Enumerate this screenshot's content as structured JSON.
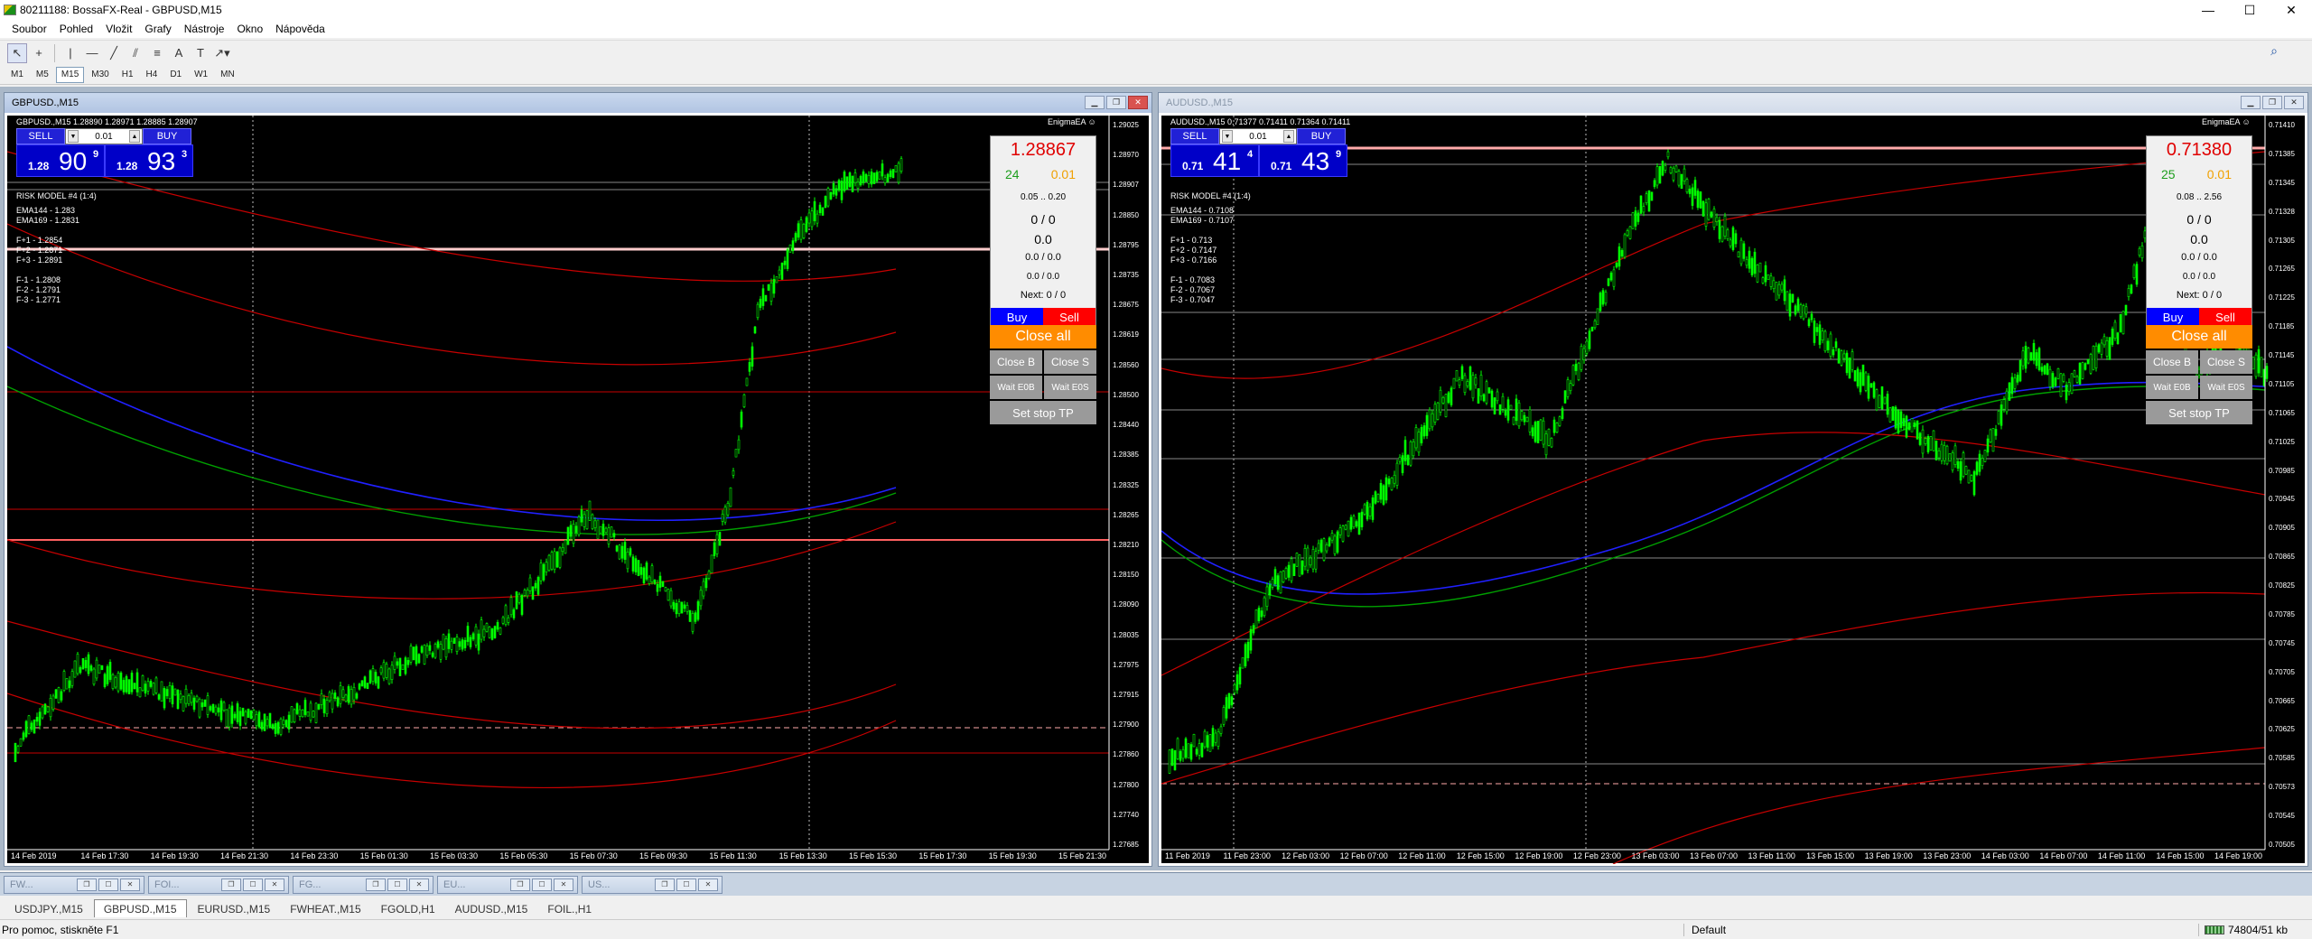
{
  "app": {
    "title": "80211188: BossaFX-Real - GBPUSD,M15",
    "controls": {
      "minimize": "—",
      "maximize": "☐",
      "close": "✕"
    }
  },
  "menu": [
    "Soubor",
    "Pohled",
    "Vložit",
    "Grafy",
    "Nástroje",
    "Okno",
    "Nápověda"
  ],
  "toolbar": {
    "tools": [
      "cursor-icon",
      "crosshair-icon",
      "vertical-line-icon",
      "horizontal-line-icon",
      "trendline-icon",
      "channel-icon",
      "fibonacci-icon",
      "text-icon",
      "label-icon",
      "arrows-icon"
    ],
    "glyphs": [
      "↖",
      "+",
      "|",
      "—",
      "╱",
      "⫽",
      "≡",
      "A",
      "T",
      "↗▾"
    ],
    "search_glyph": "⌕"
  },
  "timeframes": [
    "M1",
    "M5",
    "M15",
    "M30",
    "H1",
    "H4",
    "D1",
    "W1",
    "MN"
  ],
  "timeframe_active": "M15",
  "windows": [
    {
      "title": "GBPUSD.,M15",
      "info": "GBPUSD.,M15  1.28890 1.28971 1.28885 1.28907",
      "ea_label": "EnigmaEA ☺",
      "trade": {
        "sell": "SELL",
        "buy": "BUY",
        "lot": "0.01",
        "bid_small": "1.28",
        "bid_big": "90",
        "bid_sup": "9",
        "ask_small": "1.28",
        "ask_big": "93",
        "ask_sup": "3"
      },
      "risk": "RISK MODEL #4 (1:4)",
      "indicators": "EMA144 - 1.283\nEMA169 - 1.2831\n\nF+1 - 1.2854\nF+2 - 1.2871\nF+3 - 1.2891\n\nF-1 - 1.2808\nF-2 - 1.2791\nF-3 - 1.2771",
      "panel": {
        "price": "1.28867",
        "green": "24",
        "orange": "0.01",
        "range": "0.05 .. 0.20",
        "l1": "0 / 0",
        "l2": "0.0",
        "l3": "0.0 / 0.0",
        "l4": "0.0 / 0.0",
        "next": "Next: 0 / 0",
        "buy": "Buy",
        "sell": "Sell",
        "close_all": "Close all",
        "close_b": "Close B",
        "close_s": "Close S",
        "wait_eob": "Wait E0B",
        "wait_eos": "Wait E0S",
        "set_stop": "Set stop TP"
      },
      "price_labels": [
        "1.29025",
        "1.28970",
        "1.28907",
        "1.28850",
        "1.28795",
        "1.28735",
        "1.28675",
        "1.28619",
        "1.28560",
        "1.28500",
        "1.28440",
        "1.28385",
        "1.28325",
        "1.28265",
        "1.28210",
        "1.28150",
        "1.28090",
        "1.28035",
        "1.27975",
        "1.27915",
        "1.27900",
        "1.27860",
        "1.27800",
        "1.27740",
        "1.27685"
      ],
      "time_labels": [
        "14 Feb 2019",
        "14 Feb 17:30",
        "14 Feb 19:30",
        "14 Feb 21:30",
        "14 Feb 23:30",
        "15 Feb 01:30",
        "15 Feb 03:30",
        "15 Feb 05:30",
        "15 Feb 07:30",
        "15 Feb 09:30",
        "15 Feb 11:30",
        "15 Feb 13:30",
        "15 Feb 15:30",
        "15 Feb 17:30",
        "15 Feb 19:30",
        "15 Feb 21:30"
      ]
    },
    {
      "title": "AUDUSD.,M15",
      "info": "AUDUSD.,M15  0.71377 0.71411 0.71364 0.71411",
      "ea_label": "EnigmaEA ☺",
      "trade": {
        "sell": "SELL",
        "buy": "BUY",
        "lot": "0.01",
        "bid_small": "0.71",
        "bid_big": "41",
        "bid_sup": "4",
        "ask_small": "0.71",
        "ask_big": "43",
        "ask_sup": "9"
      },
      "risk": "RISK MODEL #4 (1:4)",
      "indicators": "EMA144 - 0.7108\nEMA169 - 0.7107\n\nF+1 - 0.713\nF+2 - 0.7147\nF+3 - 0.7166\n\nF-1 - 0.7083\nF-2 - 0.7067\nF-3 - 0.7047",
      "panel": {
        "price": "0.71380",
        "green": "25",
        "orange": "0.01",
        "range": "0.08 .. 2.56",
        "l1": "0 / 0",
        "l2": "0.0",
        "l3": "0.0 / 0.0",
        "l4": "0.0 / 0.0",
        "next": "Next: 0 / 0",
        "buy": "Buy",
        "sell": "Sell",
        "close_all": "Close all",
        "close_b": "Close B",
        "close_s": "Close S",
        "wait_eob": "Wait E0B",
        "wait_eos": "Wait E0S",
        "set_stop": "Set stop TP"
      },
      "price_labels": [
        "0.71410",
        "0.71385",
        "0.71345",
        "0.71328",
        "0.71305",
        "0.71265",
        "0.71225",
        "0.71185",
        "0.71145",
        "0.71105",
        "0.71065",
        "0.71025",
        "0.70985",
        "0.70945",
        "0.70905",
        "0.70865",
        "0.70825",
        "0.70785",
        "0.70745",
        "0.70705",
        "0.70665",
        "0.70625",
        "0.70585",
        "0.70573",
        "0.70545",
        "0.70505"
      ],
      "time_labels": [
        "11 Feb 2019",
        "11 Feb 23:00",
        "12 Feb 03:00",
        "12 Feb 07:00",
        "12 Feb 11:00",
        "12 Feb 15:00",
        "12 Feb 19:00",
        "12 Feb 23:00",
        "13 Feb 03:00",
        "13 Feb 07:00",
        "13 Feb 11:00",
        "13 Feb 15:00",
        "13 Feb 19:00",
        "13 Feb 23:00",
        "14 Feb 03:00",
        "14 Feb 07:00",
        "14 Feb 11:00",
        "14 Feb 15:00",
        "14 Feb 19:00"
      ]
    }
  ],
  "minimized": [
    "FW...",
    "FOI...",
    "FG...",
    "EU...",
    "US..."
  ],
  "tabs": [
    "USDJPY.,M15",
    "GBPUSD.,M15",
    "EURUSD.,M15",
    "FWHEAT.,M15",
    "FGOLD,H1",
    "AUDUSD.,M15",
    "FOIL.,H1"
  ],
  "active_tab": "GBPUSD.,M15",
  "status": {
    "help": "Pro pomoc, stiskněte F1",
    "profile": "Default",
    "traffic": "74804/51 kb"
  },
  "colors": {
    "buy": "#0000ff",
    "sell": "#ff0000",
    "close_all": "#ff8c00",
    "candle": "#00ff00",
    "ema144": "#0000ff",
    "ema169": "#008000",
    "bands": "#c80000"
  }
}
